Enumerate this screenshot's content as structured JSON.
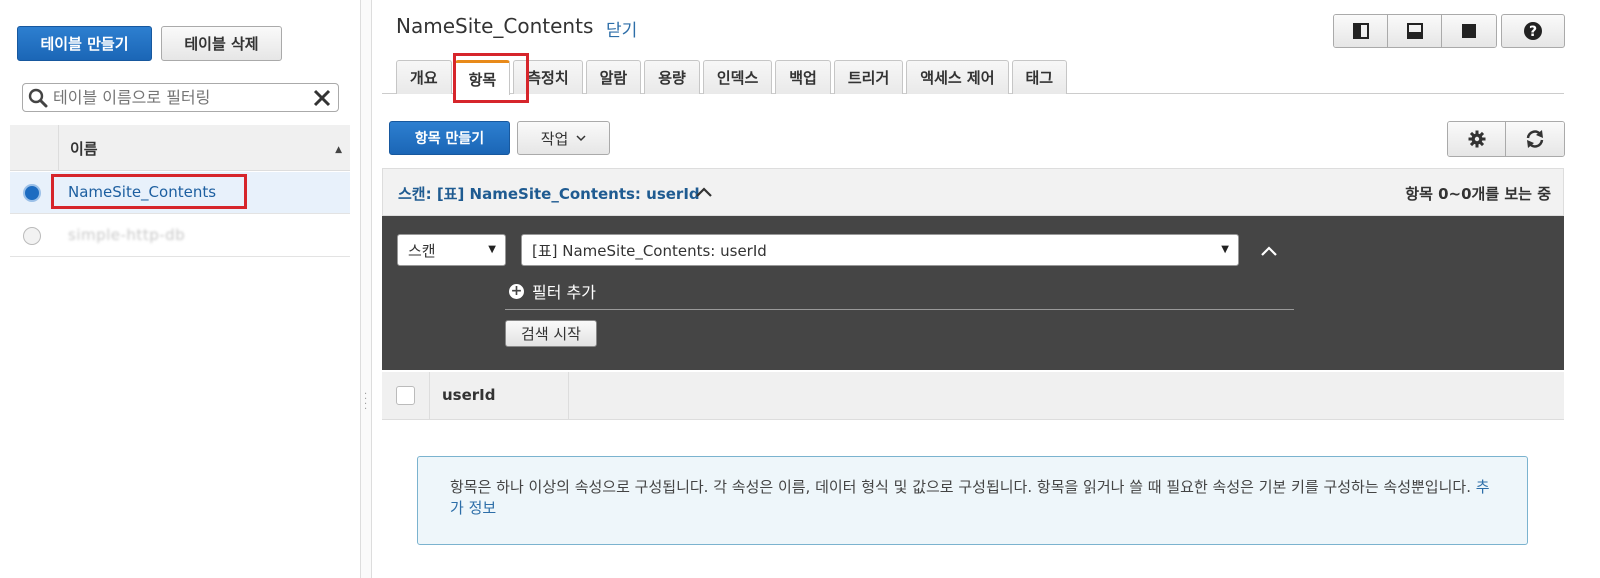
{
  "left_panel": {
    "create_table_label": "테이블 만들기",
    "delete_table_label": "테이블 삭제",
    "filter_placeholder": "테이블 이름으로 필터링",
    "table_header_name": "이름",
    "tables": [
      {
        "name": "NameSite_Contents",
        "selected": true
      },
      {
        "name": "simple-http-db",
        "selected": false
      }
    ]
  },
  "header": {
    "table_title": "NameSite_Contents",
    "close_label": "닫기"
  },
  "tabs": [
    "개요",
    "항목",
    "측정치",
    "알람",
    "용량",
    "인덱스",
    "백업",
    "트리거",
    "액세스 제어",
    "태그"
  ],
  "active_tab": "항목",
  "toolbar": {
    "create_item_label": "항목 만들기",
    "actions_label": "작업"
  },
  "scan_bar": {
    "title": "스캔: [표] NameSite_Contents: userId",
    "count_text": "항목 0~0개를 보는 중"
  },
  "query_panel": {
    "mode_value": "스캔",
    "target_value": "[표] NameSite_Contents: userId",
    "add_filter_label": "필터 추가",
    "search_start_label": "검색 시작"
  },
  "results": {
    "columns": [
      "userId"
    ]
  },
  "info": {
    "text": "항목은 하나 이상의 속성으로 구성됩니다. 각 속성은 이름, 데이터 형식 및 값으로 구성됩니다. 항목을 읽거나 쓸 때 필요한 속성은 기본 키를 구성하는 속성뿐입니다.",
    "link_label": "추가 정보"
  },
  "colors": {
    "primary_button": "#1b66b6",
    "link": "#2d6ea8",
    "highlight_box": "#d6252b",
    "active_tab_accent": "#e88a1a",
    "dark_panel": "#454545"
  }
}
